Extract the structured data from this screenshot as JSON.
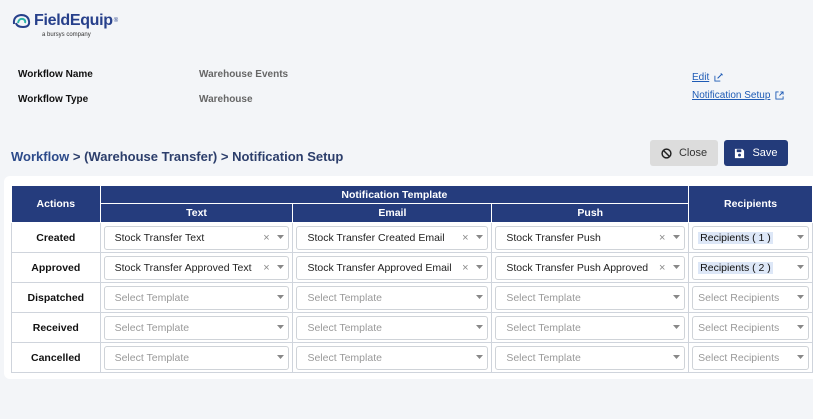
{
  "brand": {
    "name": "FieldEquip",
    "tm": "®",
    "tagline": "a bursys company"
  },
  "workflow_info": {
    "name_label": "Workflow Name",
    "name_value": "Warehouse Events",
    "type_label": "Workflow Type",
    "type_value": "Warehouse"
  },
  "links": {
    "edit": "Edit",
    "notification_setup": "Notification Setup"
  },
  "breadcrumb": {
    "root": "Workflow",
    "sep1": " > ",
    "middle": "(Warehouse Transfer)",
    "sep2": " > ",
    "current": "Notification Setup"
  },
  "buttons": {
    "close": "Close",
    "save": "Save"
  },
  "table": {
    "headers": {
      "actions": "Actions",
      "notification_template": "Notification Template",
      "text": "Text",
      "email": "Email",
      "push": "Push",
      "recipients": "Recipients"
    },
    "rows": [
      {
        "action": "Created",
        "text": "Stock Transfer Text",
        "email": "Stock Transfer Created Email",
        "push": "Stock Transfer Push",
        "recipients": "Recipients ( 1 )"
      },
      {
        "action": "Approved",
        "text": "Stock Transfer Approved Text",
        "email": "Stock Transfer Approved Email",
        "push": "Stock Transfer Push Approved",
        "recipients": "Recipients ( 2 )"
      },
      {
        "action": "Dispatched",
        "text": "",
        "email": "",
        "push": "",
        "recipients": ""
      },
      {
        "action": "Received",
        "text": "",
        "email": "",
        "push": "",
        "recipients": ""
      },
      {
        "action": "Cancelled",
        "text": "",
        "email": "",
        "push": "",
        "recipients": ""
      }
    ],
    "template_placeholder": "Select Template",
    "recipients_placeholder": "Select Recipients"
  },
  "colors": {
    "header_bg": "#253c7d",
    "save_bg": "#233b7a",
    "link": "#1e5bb5",
    "chip_bg": "#dde7f7"
  }
}
